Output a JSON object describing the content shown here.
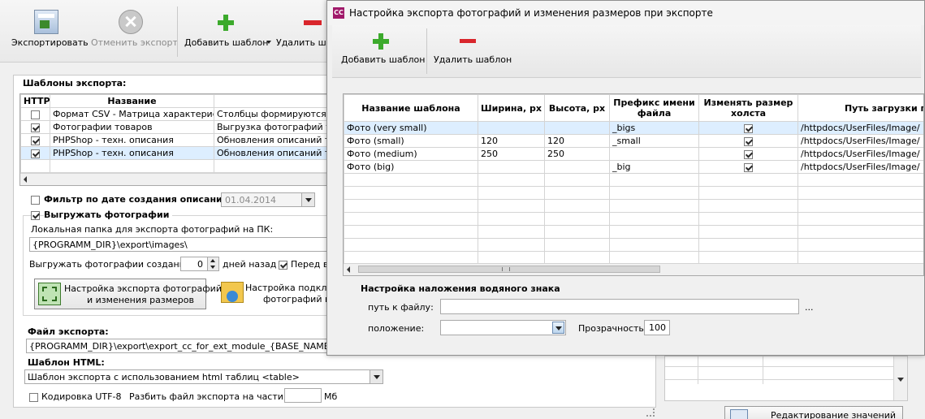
{
  "main": {
    "toolbar": {
      "export_label": "Экспортировать",
      "cancel_export_label": "Отменить экспорт",
      "add_template_label": "Добавить шаблон",
      "delete_template_label": "Удалить ша"
    },
    "templates_title": "Шаблоны экспорта:",
    "templates_table": {
      "columns": [
        "HTTP",
        "Название",
        ""
      ],
      "rows": [
        {
          "checked": false,
          "name": "Формат CSV - Матрица характеристик",
          "desc": "Столбцы формируются в п"
        },
        {
          "checked": true,
          "name": "Фотографии товаров",
          "desc": "Выгрузка фотографий тов"
        },
        {
          "checked": true,
          "name": "PHPShop - техн. описания",
          "desc": "Обновления описаний тов"
        },
        {
          "checked": true,
          "name": "PHPShop - техн. описания",
          "desc": "Обновления описаний тов"
        }
      ]
    },
    "date_filter_label": "Фильтр по дате создания описаний",
    "date_filter_value": "01.04.2014",
    "export_photos_label": "Выгружать фотографии",
    "local_folder_label": "Локальная папка для экспорта фотографий на ПК:",
    "local_folder_value": "{PROGRAMM_DIR}\\export\\images\\",
    "photos_created_label": "Выгружать фотографии созданные",
    "photos_created_days": "0",
    "days_ago_label": "дней назад",
    "before_label": "Перед в",
    "photo_settings_button": "Настройка экспорта фотографий и изменения размеров",
    "photo_settings_line1": "Настройка экспорта фотографий",
    "photo_settings_line2": "и изменения размеров",
    "connect_settings_line1": "Настройка подклю",
    "connect_settings_line2": "фотографий на",
    "export_file_label": "Файл экспорта:",
    "export_file_value": "{PROGRAMM_DIR}\\export\\export_cc_for_ext_module_{BASE_NAME}_{DA",
    "html_template_label": "Шаблон HTML:",
    "html_template_value": "Шаблон экспорта с использованием html таблиц <table>",
    "utf8_label": "Кодировка UTF-8",
    "split_label": "Разбить файл экспорта на части, по:",
    "split_unit": "Мб",
    "edit_values_label": "Редактирование значений"
  },
  "dialog": {
    "title": "Настройка экспорта фотографий и изменения размеров при экспорте",
    "icon_text": "CC",
    "toolbar": {
      "add_label": "Добавить шаблон",
      "delete_label": "Удалить шаблон"
    },
    "table": {
      "columns": [
        "Название шаблона",
        "Ширина, px",
        "Высота, px",
        "Префикс имени файла",
        "Изменять размер холста",
        "Путь загрузки по F"
      ],
      "rows": [
        {
          "name": "Фото (very small)",
          "width": "",
          "height": "",
          "prefix": "_bigs",
          "resize": true,
          "path": "/httpdocs/UserFiles/Image/"
        },
        {
          "name": "Фото (small)",
          "width": "120",
          "height": "120",
          "prefix": "_small",
          "resize": true,
          "path": "/httpdocs/UserFiles/Image/"
        },
        {
          "name": "Фото (medium)",
          "width": "250",
          "height": "250",
          "prefix": "",
          "resize": true,
          "path": "/httpdocs/UserFiles/Image/"
        },
        {
          "name": "Фото (big)",
          "width": "",
          "height": "",
          "prefix": "_big",
          "resize": true,
          "path": "/httpdocs/UserFiles/Image/"
        }
      ]
    },
    "watermark_title": "Настройка наложения водяного знака",
    "file_path_label": "путь к файлу:",
    "file_path_value": "",
    "browse_label": "...",
    "position_label": "положение:",
    "position_value": "",
    "opacity_label": "Прозрачность:",
    "opacity_value": "100"
  },
  "colors": {
    "selection_blue": "#ddeeff",
    "plus_green": "#3caa2c",
    "minus_red": "#d9262c"
  }
}
